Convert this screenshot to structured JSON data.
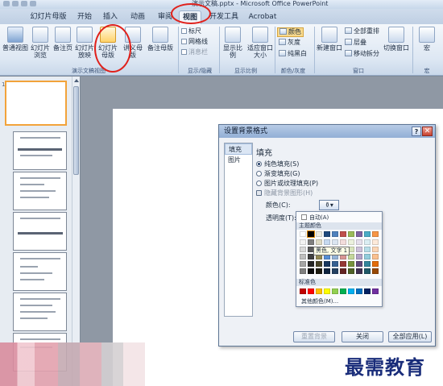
{
  "window": {
    "title": "演示文稿.pptx - Microsoft Office PowerPoint"
  },
  "tabs": [
    {
      "label": "幻灯片母版"
    },
    {
      "label": "开始"
    },
    {
      "label": "插入"
    },
    {
      "label": "动画"
    },
    {
      "label": "审阅"
    },
    {
      "label": "视图"
    },
    {
      "label": "开发工具"
    },
    {
      "label": "Acrobat"
    }
  ],
  "ribbon": {
    "presentation_views": {
      "label": "演示文稿视图",
      "normal": "普通视图",
      "sorter": "幻灯片浏览",
      "notes": "备注页",
      "reading": "幻灯片放映",
      "slide_master": "幻灯片母版",
      "handout_master": "讲义母版",
      "notes_master": "备注母版"
    },
    "show_hide": {
      "label": "显示/隐藏",
      "ruler": "标尺",
      "gridlines": "网格线",
      "message_bar": "消息栏"
    },
    "zoom": {
      "label": "显示比例",
      "zoom": "显示比例",
      "fit": "适应窗口大小"
    },
    "color": {
      "label": "颜色/灰度",
      "color": "颜色",
      "grayscale": "灰度",
      "bw": "纯黑白"
    },
    "window": {
      "label": "窗口",
      "new_window": "新建窗口",
      "arrange": "全部重排",
      "cascade": "层叠",
      "move_split": "移动拆分",
      "switch": "切换窗口"
    },
    "macro": {
      "label": "宏",
      "macro": "宏"
    }
  },
  "slides_panel": {
    "first_number": "1"
  },
  "dialog": {
    "title": "设置背景格式",
    "help": "?",
    "close": "✕",
    "nav": [
      {
        "label": "填充"
      },
      {
        "label": "图片"
      }
    ],
    "heading": "填充",
    "options": {
      "solid": "纯色填充(S)",
      "gradient": "渐变填充(G)",
      "picture": "图片或纹理填充(P)",
      "hide": "隐藏背景图形(H)"
    },
    "color_label": "颜色(C):",
    "transparency_label": "透明度(T):",
    "picker": {
      "auto": "自动(A)",
      "theme": "主题颜色",
      "standard": "标准色",
      "more": "其他颜色(M)...",
      "tooltip": "黑色, 文字 1"
    },
    "buttons": {
      "reset": "重置背景",
      "close": "关闭",
      "apply_all": "全部应用(L)"
    }
  },
  "theme_colors": {
    "top_row": [
      "#ffffff",
      "#000000",
      "#eeece1",
      "#1f497d",
      "#4f81bd",
      "#c0504d",
      "#9bbb59",
      "#8064a2",
      "#4bacc6",
      "#f79646"
    ],
    "shade_rows": [
      [
        "#f2f2f2",
        "#7f7f7f",
        "#ddd9c3",
        "#c6d9f0",
        "#dbe5f1",
        "#f2dcdb",
        "#ebf1dd",
        "#e5e0ec",
        "#dbeef3",
        "#fdeada"
      ],
      [
        "#d8d8d8",
        "#595959",
        "#c4bd97",
        "#8db3e2",
        "#b8cce4",
        "#e5b9b7",
        "#d7e3bc",
        "#ccc1d9",
        "#b7dde8",
        "#fbd5b5"
      ],
      [
        "#bfbfbf",
        "#3f3f3f",
        "#938953",
        "#548dd4",
        "#95b3d7",
        "#d99694",
        "#c3d69b",
        "#b2a2c7",
        "#92cddc",
        "#fac08f"
      ],
      [
        "#a5a5a5",
        "#262626",
        "#494429",
        "#17365d",
        "#366092",
        "#953734",
        "#76923c",
        "#5f497a",
        "#31859b",
        "#e36c09"
      ],
      [
        "#7f7f7f",
        "#0c0c0c",
        "#1d1b10",
        "#0f243e",
        "#244061",
        "#632423",
        "#4f6128",
        "#3f3151",
        "#205867",
        "#974806"
      ]
    ],
    "standard": [
      "#c00000",
      "#ff0000",
      "#ffc000",
      "#ffff00",
      "#92d050",
      "#00b050",
      "#00b0f0",
      "#0070c0",
      "#002060",
      "#7030a0"
    ]
  },
  "watermark": "最需教育"
}
